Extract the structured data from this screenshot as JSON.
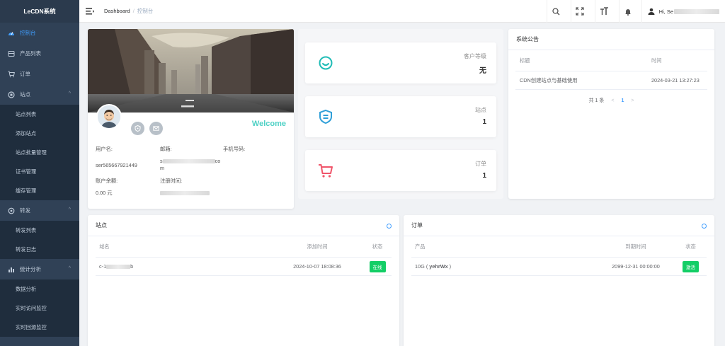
{
  "sidebar": {
    "brand": "LeCDN系统",
    "items": [
      {
        "label": "控制台",
        "icon": "dashboard-icon",
        "active": true
      },
      {
        "label": "产品列表",
        "icon": "product-icon"
      },
      {
        "label": "订单",
        "icon": "cart-icon"
      },
      {
        "label": "站点",
        "icon": "site-icon",
        "expandable": true,
        "children": [
          "站点列表",
          "添加站点",
          "站点批量管理",
          "证书管理",
          "缓存管理"
        ]
      },
      {
        "label": "转发",
        "icon": "forward-icon",
        "expandable": true,
        "children": [
          "转发列表",
          "转发日志"
        ]
      },
      {
        "label": "统计分析",
        "icon": "stats-icon",
        "expandable": true,
        "children": [
          "数据分析",
          "实时访问监控",
          "实时回源监控"
        ]
      }
    ]
  },
  "header": {
    "breadcrumb_root": "Dashboard",
    "breadcrumb_current": "控制台",
    "user_greeting": "Hi, Se"
  },
  "profile": {
    "welcome": "Welcome",
    "username_label": "用户名:",
    "username_value": "ser565667921449",
    "email_label": "邮箱:",
    "email_value_start": "s",
    "email_value_end": "co",
    "email_value_tail": "m",
    "phone_label": "手机号码:",
    "balance_label": "账户余额:",
    "balance_value": "0.00 元",
    "regtime_label": "注册时间:"
  },
  "stats": [
    {
      "label": "客户等级",
      "value": "无",
      "icon": "smile-icon",
      "color": "#1fbcb6"
    },
    {
      "label": "站点",
      "value": "1",
      "icon": "site-badge-icon",
      "color": "#2f9fd8"
    },
    {
      "label": "订单",
      "value": "1",
      "icon": "cart-icon",
      "color": "#f0556a"
    }
  ],
  "announcement": {
    "title": "系统公告",
    "col_title": "标题",
    "col_time": "时间",
    "rows": [
      {
        "title": "CDN创建站点与基础使用",
        "time": "2024-03-21 13:27:23"
      }
    ],
    "pager_total": "共 1 条",
    "pager_page": "1"
  },
  "sites": {
    "title": "站点",
    "col_domain": "域名",
    "col_added": "添加时间",
    "col_status": "状态",
    "rows": [
      {
        "domain_start": "c-1",
        "domain_end": "b",
        "added": "2024-10-07 18:08:36",
        "status": "在线"
      }
    ]
  },
  "orders": {
    "title": "订单",
    "col_product": "产品",
    "col_expire": "到期时间",
    "col_status": "状态",
    "rows": [
      {
        "product_prefix": "10G ( ",
        "product_code": "yehrWx",
        "product_suffix": " )",
        "expire": "2099-12-31 00:00:00",
        "status": "激活"
      }
    ]
  },
  "colors": {
    "sidebar_bg": "#304156",
    "accent": "#409eff",
    "success": "#13ce66",
    "welcome": "#4fd1c5"
  }
}
